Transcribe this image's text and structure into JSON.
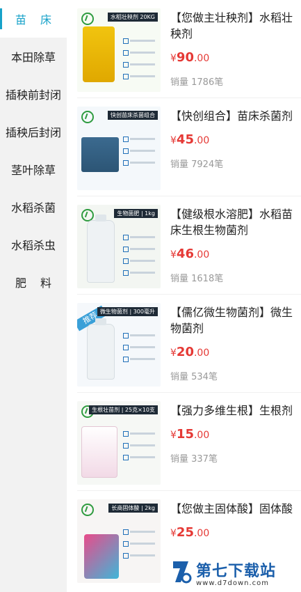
{
  "sidebar": {
    "items": [
      {
        "label": "苗床",
        "active": true
      },
      {
        "label": "本田除草"
      },
      {
        "label": "插秧前封闭"
      },
      {
        "label": "插秧后封闭"
      },
      {
        "label": "茎叶除草"
      },
      {
        "label": "水稻杀菌"
      },
      {
        "label": "水稻杀虫"
      },
      {
        "label": "肥料"
      }
    ]
  },
  "products": [
    {
      "title": "【您做主壮秧剂】水稻壮秧剂",
      "currency": "¥",
      "price_int": "90",
      "price_dec": ".00",
      "sales": "销量 1786笔",
      "tag": "水稻壮秧剂 20KG"
    },
    {
      "title": "【快创组合】苗床杀菌剂",
      "currency": "¥",
      "price_int": "45",
      "price_dec": ".00",
      "sales": "销量 7924笔",
      "tag": "快创苗床杀菌组合"
    },
    {
      "title": "【健级根水溶肥】水稻苗床生根生物菌剂",
      "currency": "¥",
      "price_int": "46",
      "price_dec": ".00",
      "sales": "销量 1618笔",
      "tag": "生物菌肥 | 1kg"
    },
    {
      "title": "【儒亿微生物菌剂】微生物菌剂",
      "currency": "¥",
      "price_int": "20",
      "price_dec": ".00",
      "sales": "销量 534笔",
      "tag": "微生物菌剂 | 300毫升",
      "badge": "推荐"
    },
    {
      "title": "【强力多维生根】生根剂",
      "currency": "¥",
      "price_int": "15",
      "price_dec": ".00",
      "sales": "销量 337笔",
      "tag": "生根壮苗剂 | 25克×10支"
    },
    {
      "title": "【您做主固体酸】固体酸",
      "currency": "¥",
      "price_int": "25",
      "price_dec": ".00",
      "sales": "",
      "tag": "长商固体酸 | 2kg"
    }
  ],
  "watermark": {
    "brand": "第七下载站",
    "url": "www.d7down.com"
  },
  "colors": {
    "accent": "#17a2c9",
    "price": "#e53935",
    "sidebar_bg": "#f2f2f2"
  }
}
